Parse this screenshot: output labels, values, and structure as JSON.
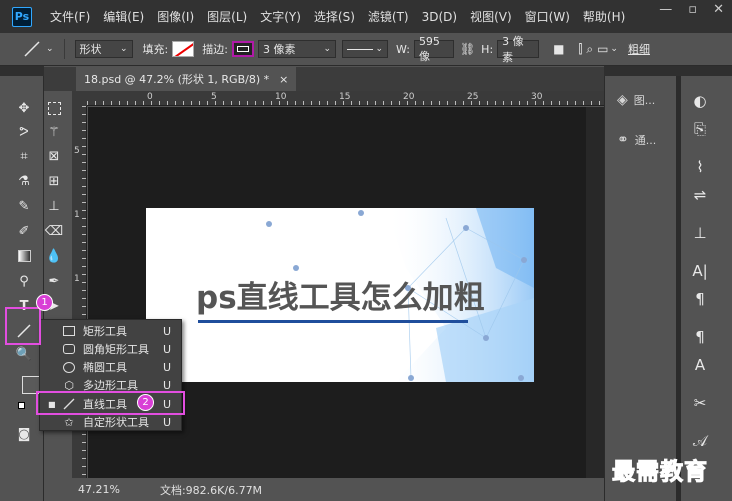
{
  "app": {
    "logo": "Ps"
  },
  "menu": [
    "文件(F)",
    "编辑(E)",
    "图像(I)",
    "图层(L)",
    "文字(Y)",
    "选择(S)",
    "滤镜(T)",
    "3D(D)",
    "视图(V)",
    "窗口(W)",
    "帮助(H)"
  ],
  "options": {
    "mode_value": "形状",
    "fill_label": "填充:",
    "stroke_label": "描边:",
    "stroke_width": "3 像素",
    "w_label": "W:",
    "w_value": "595 像",
    "h_label": "H:",
    "h_value": "3 像素",
    "overflow_label": "粗细"
  },
  "document": {
    "tab_title": "18.psd @ 47.2% (形状 1, RGB/8) *",
    "tab_close": "×",
    "zoom": "47.21%",
    "doc_info": "文档:982.6K/6.77M"
  },
  "ruler": {
    "h_labels": [
      "0",
      "5",
      "10",
      "15",
      "20",
      "25",
      "30"
    ],
    "v_labels": [
      "5",
      "1",
      "1",
      "2",
      "2"
    ]
  },
  "artwork": {
    "title": "ps直线工具怎么加粗",
    "underline_color": "#1f4e9c"
  },
  "panels": {
    "layers_label": "图...",
    "channels_label": "通..."
  },
  "flyout": {
    "items": [
      {
        "label": "矩形工具",
        "key": "U"
      },
      {
        "label": "圆角矩形工具",
        "key": "U"
      },
      {
        "label": "椭圆工具",
        "key": "U"
      },
      {
        "label": "多边形工具",
        "key": "U"
      },
      {
        "label": "直线工具",
        "key": "U"
      },
      {
        "label": "自定形状工具",
        "key": "U"
      }
    ]
  },
  "badges": {
    "one": "1",
    "two": "2"
  },
  "watermark": "最需教育"
}
